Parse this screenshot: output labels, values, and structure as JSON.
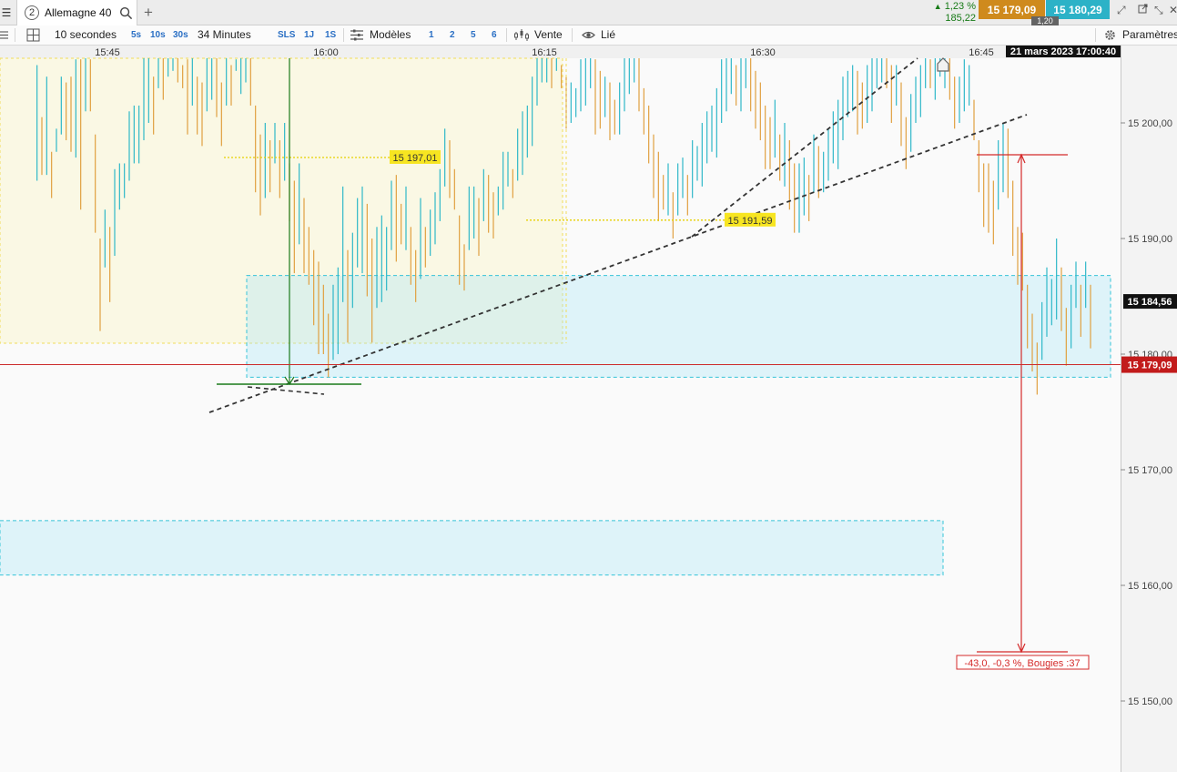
{
  "tabbar": {
    "menu_icon": "hamburger-menu-icon",
    "tab_number": "2",
    "tab_title": "Allemagne 40",
    "search_icon": "search-icon",
    "add_icon": "plus-icon",
    "change_pct": "1,23 %",
    "change_abs": "185,22",
    "change_arrow": "▲",
    "bid": "15 179,09",
    "ask": "15 180,29",
    "spread": "1,20",
    "colors": {
      "bid": "#cf8a1d",
      "ask": "#2cb2c7",
      "up": "#167a16"
    }
  },
  "toolbar": {
    "interval": "10 secondes",
    "quick_5s": "5s",
    "quick_10s": "10s",
    "quick_30s": "30s",
    "duration": "34 Minutes",
    "sls": "SLS",
    "range_1j": "1J",
    "range_1s": "1S",
    "models": "Modèles",
    "preset_1": "1",
    "preset_2": "2",
    "preset_5": "5",
    "preset_6": "6",
    "sell": "Vente",
    "link": "Lié",
    "settings": "Paramètres"
  },
  "chart_data": {
    "type": "candlestick",
    "instrument": "Allemagne 40",
    "date_label": "21 mars 2023 17:00:40",
    "x_ticks": [
      "15:45",
      "16:00",
      "16:15",
      "16:30",
      "16:45"
    ],
    "y_ticks": [
      "15 200,00",
      "15 190,00",
      "15 180,00",
      "15 170,00",
      "15 160,00",
      "15 150,00"
    ],
    "ylim": [
      15145,
      15208
    ],
    "x_time_range": [
      "15:39:50",
      "16:51:00"
    ],
    "colors": {
      "up": "#2fb8c8",
      "down": "#e0a040"
    },
    "last_price": "15 179,09",
    "last_price_value": 15179.09,
    "crosshair_price": "15 184,56",
    "annotations": [
      {
        "label": "15 197,01",
        "price": 15197.01
      },
      {
        "label": "15 191,59",
        "price": 15191.59
      },
      {
        "label": "-43,0, -0,3 %, Bougies :37"
      }
    ],
    "support_zones": [
      {
        "price_top": 15186.8,
        "price_bottom": 15178.0
      },
      {
        "price_top": 15165.6,
        "price_bottom": 15160.9
      }
    ],
    "candles": [
      [
        1,
        15205.0,
        15195.0
      ],
      [
        2,
        15200.5,
        15195.5
      ],
      [
        3,
        15204.0,
        15195.5
      ],
      [
        4,
        15197.5,
        15193.5
      ],
      [
        5,
        15199.5,
        15197.5
      ],
      [
        6,
        15204.0,
        15199.0
      ],
      [
        7,
        15203.5,
        15198.5
      ],
      [
        8,
        15204.0,
        15197.5
      ],
      [
        9,
        15205.5,
        15197.0
      ],
      [
        10,
        15205.5,
        15192.5
      ],
      [
        11,
        15206.5,
        15201.0
      ],
      [
        12,
        15205.5,
        15201.0
      ],
      [
        13,
        15199.0,
        15190.5
      ],
      [
        14,
        15190.0,
        15182.0
      ],
      [
        15,
        15192.5,
        15187.5
      ],
      [
        16,
        15191.0,
        15184.5
      ],
      [
        17,
        15196.0,
        15188.5
      ],
      [
        18,
        15196.5,
        15192.5
      ],
      [
        19,
        15196.5,
        15193.5
      ],
      [
        20,
        15201.0,
        15195.0
      ],
      [
        21,
        15201.5,
        15196.5
      ],
      [
        22,
        15201.5,
        15196.5
      ],
      [
        23,
        15206.5,
        15198.5
      ],
      [
        24,
        15206.0,
        15200.0
      ],
      [
        25,
        15204.0,
        15199.0
      ],
      [
        26,
        15208.0,
        15203.0
      ],
      [
        27,
        15208.0,
        15202.0
      ],
      [
        28,
        15206.5,
        15204.0
      ],
      [
        29,
        15207.0,
        15204.5
      ],
      [
        30,
        15207.0,
        15203.5
      ],
      [
        31,
        15205.0,
        15203.0
      ],
      [
        32,
        15205.5,
        15199.0
      ],
      [
        33,
        15206.0,
        15201.5
      ],
      [
        34,
        15204.0,
        15199.0
      ],
      [
        35,
        15203.5,
        15198.0
      ],
      [
        36,
        15207.0,
        15201.0
      ],
      [
        37,
        15207.5,
        15202.0
      ],
      [
        38,
        15206.0,
        15200.5
      ],
      [
        39,
        15203.5,
        15198.0
      ],
      [
        40,
        15207.0,
        15201.5
      ],
      [
        41,
        15205.0,
        15201.5
      ],
      [
        42,
        15205.5,
        15204.5
      ],
      [
        43,
        15207.5,
        15202.5
      ],
      [
        44,
        15207.0,
        15203.5
      ],
      [
        45,
        15206.5,
        15201.5
      ],
      [
        46,
        15201.5,
        15194.0
      ],
      [
        47,
        15199.0,
        15192.0
      ],
      [
        48,
        15200.0,
        15193.5
      ],
      [
        49,
        15198.5,
        15194.0
      ],
      [
        50,
        15200.0,
        15196.5
      ],
      [
        51,
        15198.5,
        15193.5
      ],
      [
        52,
        15200.0,
        15195.0
      ],
      [
        53,
        15196.5,
        15191.5
      ],
      [
        54,
        15195.0,
        15187.0
      ],
      [
        55,
        15196.5,
        15189.5
      ],
      [
        56,
        15193.5,
        15187.0
      ],
      [
        57,
        15191.0,
        15186.0
      ],
      [
        58,
        15189.0,
        15182.5
      ],
      [
        59,
        15188.0,
        15180.0
      ],
      [
        60,
        15186.0,
        15180.0
      ],
      [
        61,
        15183.5,
        15178.0
      ],
      [
        62,
        15186.0,
        15179.5
      ],
      [
        63,
        15187.5,
        15180.0
      ],
      [
        64,
        15194.5,
        15184.5
      ],
      [
        65,
        15189.0,
        15181.0
      ],
      [
        66,
        15190.5,
        15184.0
      ],
      [
        67,
        15193.5,
        15187.5
      ],
      [
        68,
        15194.5,
        15187.0
      ],
      [
        69,
        15193.0,
        15185.0
      ],
      [
        70,
        15190.0,
        15181.0
      ],
      [
        71,
        15191.0,
        15184.0
      ],
      [
        72,
        15192.0,
        15184.5
      ],
      [
        73,
        15191.0,
        15185.5
      ],
      [
        74,
        15195.0,
        15189.0
      ],
      [
        75,
        15195.5,
        15188.0
      ],
      [
        76,
        15193.0,
        15189.5
      ],
      [
        77,
        15194.5,
        15189.0
      ],
      [
        78,
        15191.0,
        15186.0
      ],
      [
        79,
        15189.0,
        15184.5
      ],
      [
        80,
        15193.5,
        15186.5
      ],
      [
        81,
        15191.0,
        15187.5
      ],
      [
        82,
        15192.5,
        15188.5
      ],
      [
        83,
        15194.0,
        15189.5
      ],
      [
        84,
        15196.0,
        15191.5
      ],
      [
        85,
        15199.5,
        15194.5
      ],
      [
        86,
        15198.5,
        15193.5
      ],
      [
        87,
        15196.0,
        15192.5
      ],
      [
        88,
        15192.0,
        15186.0
      ],
      [
        89,
        15189.5,
        15185.5
      ],
      [
        90,
        15194.5,
        15189.0
      ],
      [
        91,
        15194.5,
        15190.0
      ],
      [
        92,
        15193.5,
        15188.5
      ],
      [
        93,
        15196.0,
        15191.5
      ],
      [
        94,
        15195.5,
        15190.5
      ],
      [
        95,
        15194.0,
        15190.0
      ],
      [
        96,
        15194.5,
        15192.0
      ],
      [
        97,
        15197.5,
        15192.5
      ],
      [
        98,
        15197.5,
        15194.5
      ],
      [
        99,
        15196.0,
        15193.5
      ],
      [
        100,
        15199.5,
        15195.0
      ],
      [
        101,
        15201.0,
        15195.5
      ],
      [
        102,
        15201.5,
        15197.0
      ],
      [
        103,
        15204.0,
        15198.0
      ],
      [
        104,
        15206.0,
        15201.5
      ],
      [
        105,
        15207.5,
        15203.5
      ],
      [
        106,
        15208.0,
        15203.5
      ],
      [
        107,
        15206.5,
        15203.0
      ],
      [
        108,
        15207.5,
        15204.5
      ],
      [
        109,
        15205.0,
        15203.0
      ],
      [
        110,
        15204.0,
        15199.5
      ],
      [
        111,
        15203.5,
        15200.0
      ],
      [
        112,
        15203.0,
        15200.5
      ],
      [
        113,
        15205.5,
        15201.0
      ],
      [
        114,
        15207.0,
        15201.5
      ],
      [
        115,
        15208.0,
        15203.0
      ],
      [
        116,
        15205.5,
        15199.0
      ],
      [
        117,
        15204.5,
        15199.5
      ],
      [
        118,
        15204.0,
        15200.5
      ],
      [
        119,
        15203.5,
        15198.5
      ],
      [
        120,
        15202.0,
        15199.0
      ],
      [
        121,
        15203.5,
        15199.0
      ],
      [
        122,
        15206.5,
        15201.0
      ],
      [
        123,
        15207.5,
        15202.5
      ],
      [
        124,
        15207.0,
        15203.5
      ],
      [
        125,
        15206.0,
        15201.0
      ],
      [
        126,
        15203.0,
        15199.0
      ],
      [
        127,
        15201.5,
        15196.5
      ],
      [
        128,
        15199.0,
        15193.5
      ],
      [
        129,
        15197.5,
        15191.5
      ],
      [
        130,
        15195.5,
        15192.5
      ],
      [
        131,
        15196.5,
        15192.0
      ],
      [
        132,
        15194.0,
        15190.0
      ],
      [
        133,
        15196.5,
        15192.0
      ],
      [
        134,
        15197.0,
        15193.5
      ],
      [
        135,
        15195.5,
        15192.0
      ],
      [
        136,
        15198.5,
        15193.5
      ],
      [
        137,
        15198.0,
        15195.0
      ],
      [
        138,
        15200.0,
        15194.5
      ],
      [
        139,
        15201.0,
        15196.5
      ],
      [
        140,
        15201.5,
        15197.5
      ],
      [
        141,
        15203.0,
        15197.0
      ],
      [
        142,
        15205.5,
        15200.0
      ],
      [
        143,
        15207.0,
        15201.0
      ],
      [
        144,
        15206.5,
        15202.5
      ],
      [
        145,
        15205.0,
        15201.5
      ],
      [
        146,
        15207.0,
        15201.0
      ],
      [
        147,
        15206.5,
        15203.0
      ],
      [
        148,
        15206.0,
        15201.0
      ],
      [
        149,
        15204.5,
        15199.5
      ],
      [
        150,
        15203.5,
        15198.5
      ],
      [
        151,
        15201.5,
        15196.0
      ],
      [
        152,
        15200.5,
        15196.0
      ],
      [
        153,
        15202.0,
        15197.0
      ],
      [
        154,
        15199.0,
        15195.0
      ],
      [
        155,
        15200.0,
        15194.5
      ],
      [
        156,
        15198.5,
        15192.5
      ],
      [
        157,
        15196.5,
        15190.5
      ],
      [
        158,
        15196.5,
        15190.5
      ],
      [
        159,
        15197.0,
        15192.0
      ],
      [
        160,
        15195.5,
        15191.5
      ],
      [
        161,
        15199.0,
        15194.0
      ],
      [
        162,
        15198.0,
        15193.5
      ],
      [
        163,
        15197.5,
        15194.0
      ],
      [
        164,
        15199.5,
        15195.0
      ],
      [
        165,
        15201.0,
        15196.5
      ],
      [
        166,
        15202.0,
        15196.0
      ],
      [
        167,
        15204.0,
        15198.5
      ],
      [
        168,
        15204.5,
        15200.5
      ],
      [
        169,
        15205.0,
        15201.0
      ],
      [
        170,
        15204.5,
        15199.0
      ],
      [
        171,
        15203.5,
        15199.5
      ],
      [
        172,
        15205.0,
        15200.0
      ],
      [
        173,
        15206.0,
        15201.0
      ],
      [
        174,
        15207.5,
        15203.0
      ],
      [
        175,
        15208.0,
        15203.5
      ],
      [
        176,
        15206.5,
        15203.0
      ],
      [
        177,
        15205.0,
        15200.0
      ],
      [
        178,
        15205.0,
        15201.5
      ],
      [
        179,
        15203.5,
        15198.0
      ],
      [
        180,
        15200.5,
        15196.0
      ],
      [
        181,
        15202.5,
        15197.5
      ],
      [
        182,
        15204.0,
        15200.0
      ],
      [
        183,
        15205.0,
        15200.5
      ],
      [
        184,
        15207.0,
        15203.0
      ],
      [
        185,
        15205.5,
        15203.0
      ],
      [
        186,
        15207.5,
        15202.0
      ],
      [
        187,
        15206.0,
        15204.0
      ],
      [
        188,
        15208.0,
        15203.0
      ],
      [
        189,
        15206.0,
        15202.0
      ],
      [
        190,
        15204.0,
        15199.5
      ],
      [
        191,
        15204.0,
        15200.0
      ],
      [
        192,
        15205.5,
        15201.0
      ],
      [
        193,
        15205.0,
        15201.5
      ],
      [
        194,
        15202.0,
        15198.5
      ],
      [
        195,
        15198.5,
        15194.0
      ],
      [
        196,
        15196.5,
        15191.0
      ],
      [
        197,
        15196.5,
        15190.5
      ],
      [
        198,
        15195.0,
        15189.5
      ],
      [
        199,
        15198.5,
        15192.5
      ],
      [
        200,
        15200.0,
        15194.0
      ],
      [
        201,
        15199.5,
        15193.5
      ],
      [
        202,
        15195.0,
        15188.5
      ],
      [
        203,
        15191.0,
        15186.0
      ],
      [
        204,
        15190.5,
        15185.5
      ],
      [
        205,
        15186.0,
        15180.5
      ],
      [
        206,
        15183.5,
        15178.5
      ],
      [
        207,
        15181.0,
        15176.5
      ],
      [
        208,
        15184.5,
        15179.5
      ],
      [
        209,
        15187.5,
        15181.5
      ],
      [
        210,
        15186.5,
        15182.5
      ],
      [
        211,
        15190.0,
        15183.0
      ],
      [
        212,
        15187.5,
        15182.0
      ],
      [
        213,
        15184.0,
        15179.0
      ],
      [
        214,
        15186.0,
        15180.5
      ],
      [
        215,
        15188.0,
        15184.0
      ],
      [
        216,
        15186.0,
        15181.5
      ],
      [
        217,
        15188.0,
        15184.0
      ],
      [
        218,
        15186.0,
        15180.5
      ]
    ]
  }
}
